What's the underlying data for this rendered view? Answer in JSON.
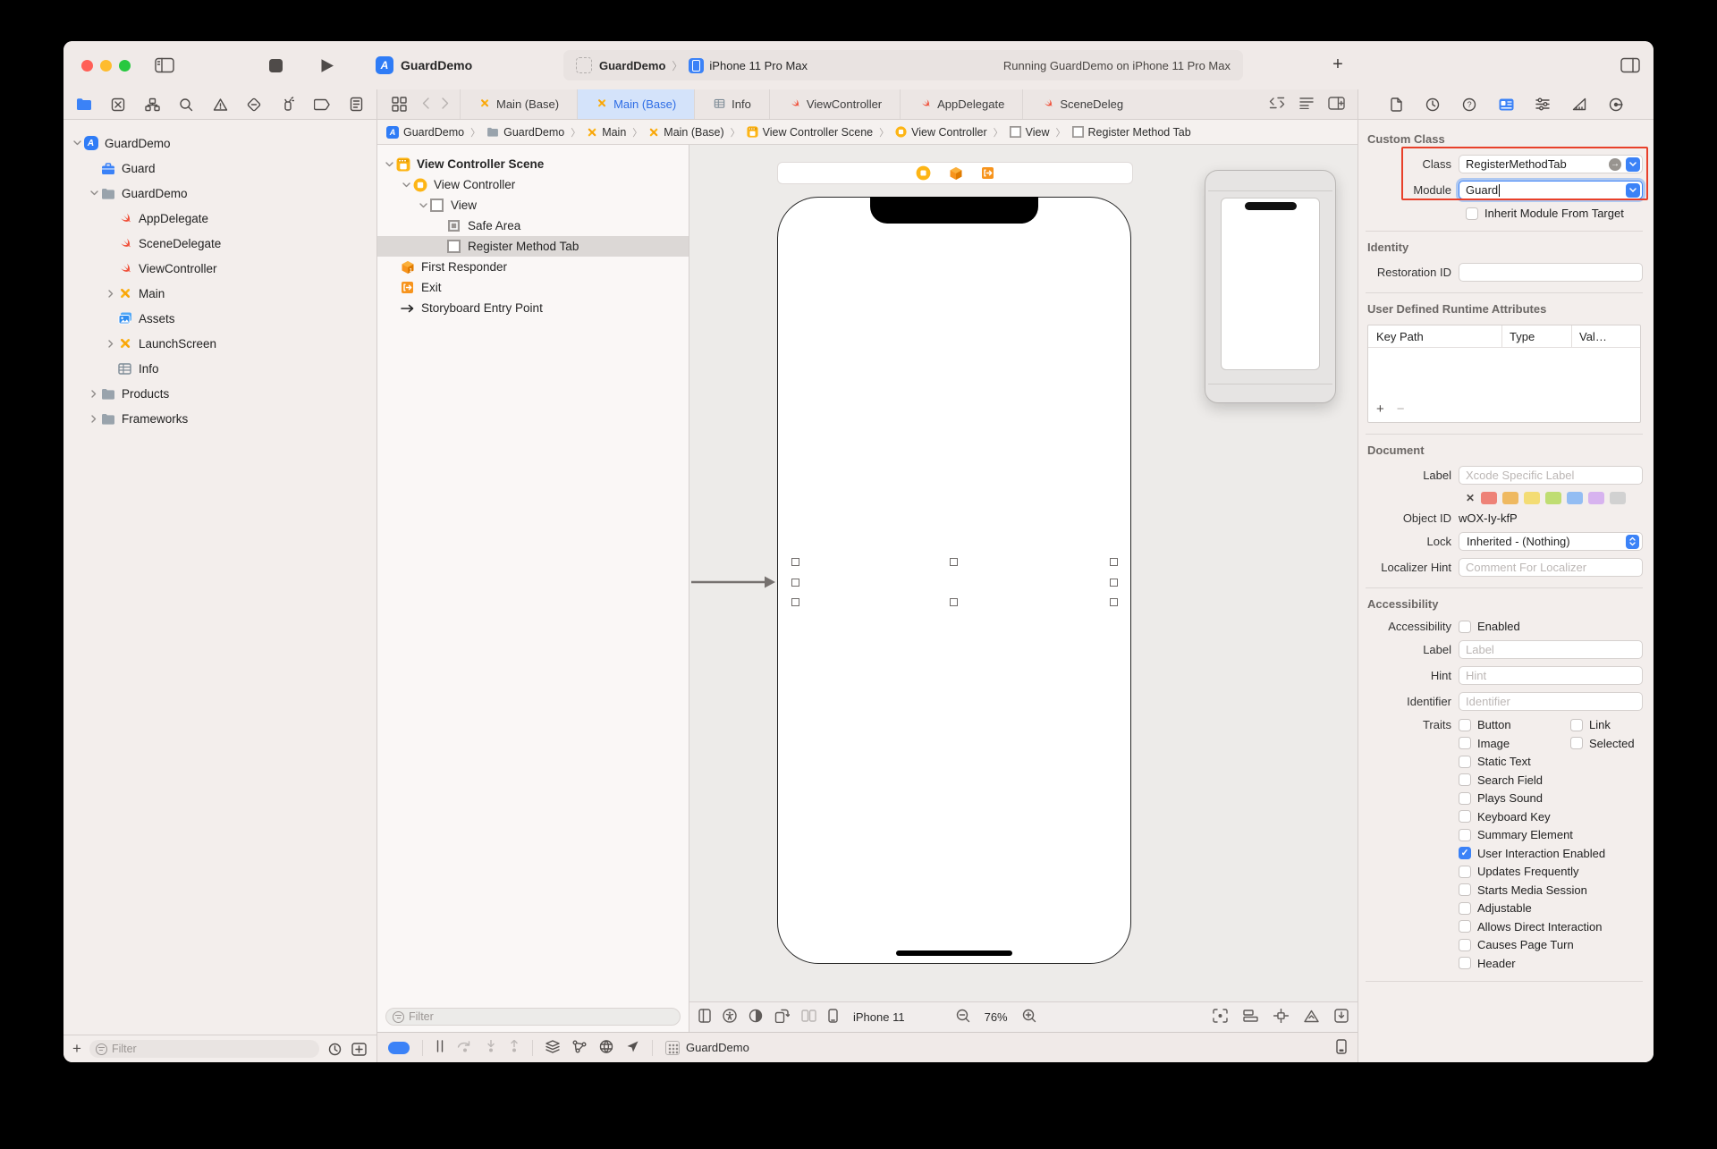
{
  "toolbar": {
    "project": "GuardDemo",
    "scheme_app": "GuardDemo",
    "scheme_device": "iPhone 11 Pro Max",
    "status": "Running GuardDemo on iPhone 11 Pro Max",
    "new_tab_label": "+"
  },
  "tabs": {
    "items": [
      {
        "label": "Main (Base)"
      },
      {
        "label": "Main (Base)"
      },
      {
        "label": "Info"
      },
      {
        "label": "ViewController"
      },
      {
        "label": "AppDelegate"
      },
      {
        "label": "SceneDeleg"
      }
    ]
  },
  "navigator": {
    "items": [
      {
        "label": "GuardDemo"
      },
      {
        "label": "Guard"
      },
      {
        "label": "GuardDemo"
      },
      {
        "label": "AppDelegate"
      },
      {
        "label": "SceneDelegate"
      },
      {
        "label": "ViewController"
      },
      {
        "label": "Main"
      },
      {
        "label": "Assets"
      },
      {
        "label": "LaunchScreen"
      },
      {
        "label": "Info"
      },
      {
        "label": "Products"
      },
      {
        "label": "Frameworks"
      }
    ],
    "filter_placeholder": "Filter"
  },
  "jumpbar": {
    "items": [
      {
        "label": "GuardDemo"
      },
      {
        "label": "GuardDemo"
      },
      {
        "label": "Main"
      },
      {
        "label": "Main (Base)"
      },
      {
        "label": "View Controller Scene"
      },
      {
        "label": "View Controller"
      },
      {
        "label": "View"
      },
      {
        "label": "Register Method Tab"
      }
    ]
  },
  "outline": {
    "items": [
      {
        "label": "View Controller Scene"
      },
      {
        "label": "View Controller"
      },
      {
        "label": "View"
      },
      {
        "label": "Safe Area"
      },
      {
        "label": "Register Method Tab"
      },
      {
        "label": "First Responder"
      },
      {
        "label": "Exit"
      },
      {
        "label": "Storyboard Entry Point"
      }
    ],
    "filter_placeholder": "Filter"
  },
  "canvas": {
    "device_label": "iPhone 11",
    "zoom_level": "76%"
  },
  "debugbar": {
    "app_label": "GuardDemo"
  },
  "inspector": {
    "custom_class": {
      "title": "Custom Class",
      "class_label": "Class",
      "class_value": "RegisterMethodTab",
      "module_label": "Module",
      "module_value": "Guard",
      "inherit_label": "Inherit Module From Target"
    },
    "identity": {
      "title": "Identity",
      "restoration_label": "Restoration ID"
    },
    "runtime_attrs": {
      "title": "User Defined Runtime Attributes",
      "col_keypath": "Key Path",
      "col_type": "Type",
      "col_value": "Val…",
      "add_label": "+",
      "remove_label": "−"
    },
    "document": {
      "title": "Document",
      "label_label": "Label",
      "label_placeholder": "Xcode Specific Label",
      "object_id_label": "Object ID",
      "object_id_value": "wOX-Iy-kfP",
      "lock_label": "Lock",
      "lock_value": "Inherited - (Nothing)",
      "localizer_label": "Localizer Hint",
      "localizer_placeholder": "Comment For Localizer",
      "swatch_colors": [
        "#ee8277",
        "#efb960",
        "#f3dc74",
        "#bfdd72",
        "#93bdf3",
        "#d7b3ef",
        "#d1d1d1"
      ]
    },
    "accessibility": {
      "title": "Accessibility",
      "accessibility_label": "Accessibility",
      "enabled_label": "Enabled",
      "label_label": "Label",
      "label_placeholder": "Label",
      "hint_label": "Hint",
      "hint_placeholder": "Hint",
      "identifier_label": "Identifier",
      "identifier_placeholder": "Identifier",
      "traits_label": "Traits",
      "traits": [
        {
          "label": "Button",
          "checked": false
        },
        {
          "label": "Link",
          "checked": false
        },
        {
          "label": "Image",
          "checked": false
        },
        {
          "label": "Selected",
          "checked": false
        },
        {
          "label": "Static Text",
          "checked": false
        },
        {
          "label": "Search Field",
          "checked": false
        },
        {
          "label": "Plays Sound",
          "checked": false
        },
        {
          "label": "Keyboard Key",
          "checked": false
        },
        {
          "label": "Summary Element",
          "checked": false
        },
        {
          "label": "User Interaction Enabled",
          "checked": true
        },
        {
          "label": "Updates Frequently",
          "checked": false
        },
        {
          "label": "Starts Media Session",
          "checked": false
        },
        {
          "label": "Adjustable",
          "checked": false
        },
        {
          "label": "Allows Direct Interaction",
          "checked": false
        },
        {
          "label": "Causes Page Turn",
          "checked": false
        },
        {
          "label": "Header",
          "checked": false
        }
      ]
    }
  }
}
